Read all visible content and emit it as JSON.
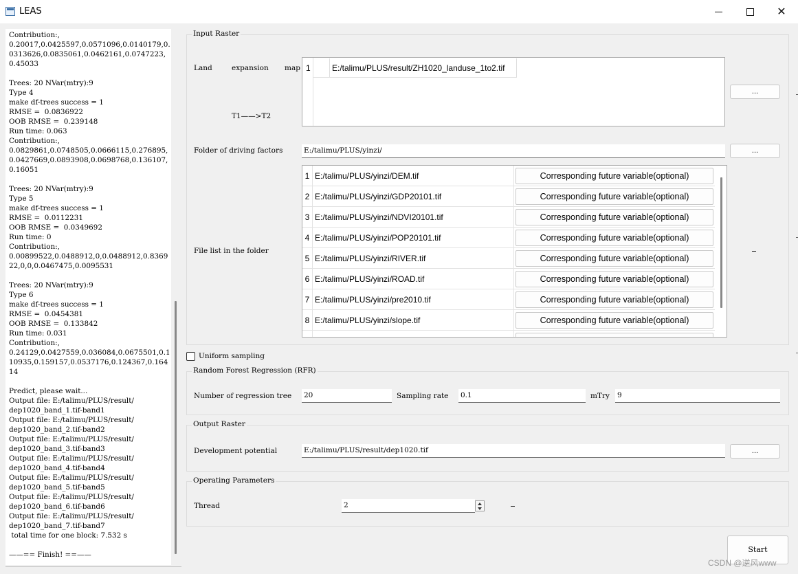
{
  "window": {
    "title": "LEAS"
  },
  "log": {
    "text": "Contribution:,\n0.20017,0.0425597,0.0571096,0.0140179,0.0313626,0.0835061,0.0462161,0.0747223,0.45033\n\nTrees: 20 NVar(mtry):9\nType 4\nmake df-trees success = 1\nRMSE =  0.0836922\nOOB RMSE =  0.239148\nRun time: 0.063\nContribution:,\n0.0829861,0.0748505,0.0666115,0.276895,0.0427669,0.0893908,0.0698768,0.136107,0.16051\n\nTrees: 20 NVar(mtry):9\nType 5\nmake df-trees success = 1\nRMSE =  0.0112231\nOOB RMSE =  0.0349692\nRun time: 0\nContribution:,\n0.00899522,0.0488912,0,0.0488912,0.836922,0,0,0.0467475,0.0095531\n\nTrees: 20 NVar(mtry):9\nType 6\nmake df-trees success = 1\nRMSE =  0.0454381\nOOB RMSE =  0.133842\nRun time: 0.031\nContribution:,\n0.24129,0.0427559,0.036084,0.0675501,0.110935,0.159157,0.0537176,0.124367,0.16414\n\nPredict, please wait...\nOutput file: E:/talimu/PLUS/result/\ndep1020_band_1.tif-band1\nOutput file: E:/talimu/PLUS/result/\ndep1020_band_2.tif-band2\nOutput file: E:/talimu/PLUS/result/\ndep1020_band_3.tif-band3\nOutput file: E:/talimu/PLUS/result/\ndep1020_band_4.tif-band4\nOutput file: E:/talimu/PLUS/result/\ndep1020_band_5.tif-band5\nOutput file: E:/talimu/PLUS/result/\ndep1020_band_6.tif-band6\nOutput file: E:/talimu/PLUS/result/\ndep1020_band_7.tif-band7\n total time for one block: 7.532 s\n\n——== Finish! ==——"
  },
  "input_raster": {
    "title": "Input Raster",
    "land_label_1": "Land",
    "land_label_2": "expansion",
    "land_label_3": "map",
    "land_sub_label": "T1——>T2",
    "land_row_num": "1",
    "land_path": "E:/talimu/PLUS/result/ZH1020_landuse_1to2.tif",
    "browse_label": "...",
    "folder_label": "Folder of driving factors",
    "folder_value": "E:/talimu/PLUS/yinzi/",
    "file_list_label": "File list in the folder",
    "file_button_label": "Corresponding future variable(optional)",
    "files": [
      {
        "num": "1",
        "path": "E:/talimu/PLUS/yinzi/DEM.tif"
      },
      {
        "num": "2",
        "path": "E:/talimu/PLUS/yinzi/GDP20101.tif"
      },
      {
        "num": "3",
        "path": "E:/talimu/PLUS/yinzi/NDVI20101.tif"
      },
      {
        "num": "4",
        "path": "E:/talimu/PLUS/yinzi/POP20101.tif"
      },
      {
        "num": "5",
        "path": "E:/talimu/PLUS/yinzi/RIVER.tif"
      },
      {
        "num": "6",
        "path": "E:/talimu/PLUS/yinzi/ROAD.tif"
      },
      {
        "num": "7",
        "path": "E:/talimu/PLUS/yinzi/pre2010.tif"
      },
      {
        "num": "8",
        "path": "E:/talimu/PLUS/yinzi/slope.tif"
      }
    ]
  },
  "uniform_sampling": {
    "label": "Uniform sampling",
    "checked": false
  },
  "rfr": {
    "title": "Random Forest Regression (RFR)",
    "trees_label": "Number of regression tree",
    "trees_value": "20",
    "rate_label": "Sampling rate",
    "rate_value": "0.1",
    "mtry_label": "mTry",
    "mtry_value": "9"
  },
  "output_raster": {
    "title": "Output Raster",
    "dev_label": "Development potential",
    "dev_value": "E:/talimu/PLUS/result/dep1020.tif",
    "browse_label": "..."
  },
  "operating": {
    "title": "Operating Parameters",
    "thread_label": "Thread",
    "thread_value": "2"
  },
  "start_label": "Start",
  "watermark": "CSDN @逆风www"
}
